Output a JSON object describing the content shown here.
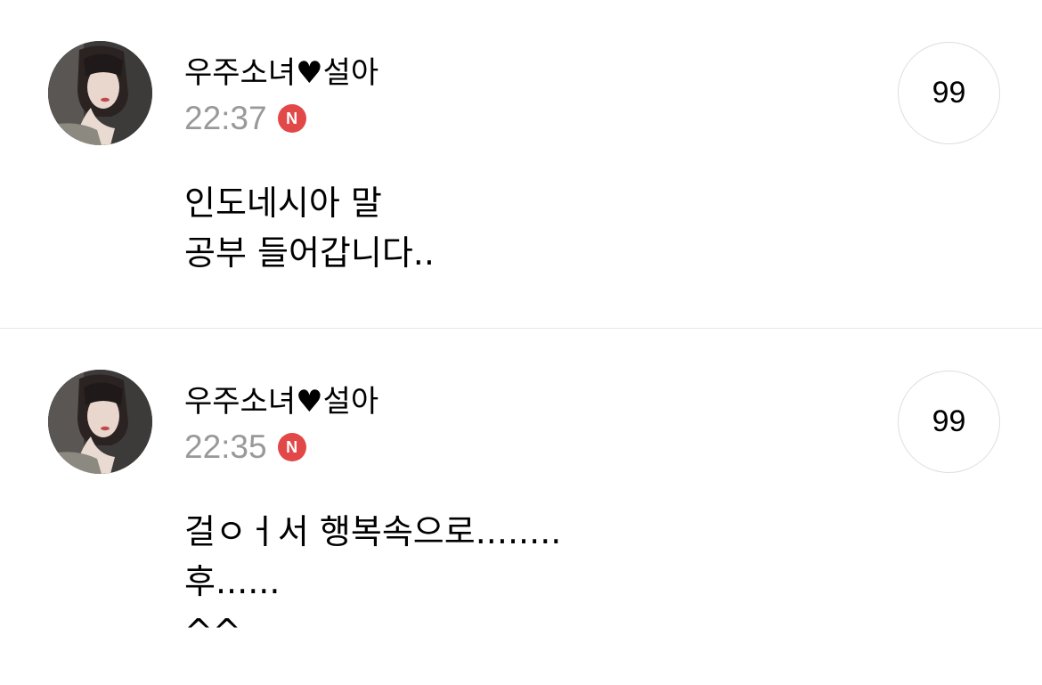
{
  "posts": [
    {
      "author": "우주소녀♥설아",
      "time": "22:37",
      "badge": "N",
      "count": "99",
      "lines": [
        "인도네시아 말",
        "공부 들어갑니다.."
      ]
    },
    {
      "author": "우주소녀♥설아",
      "time": "22:35",
      "badge": "N",
      "count": "99",
      "lines": [
        "걸ㅇㅓ서 행복속으로........",
        "후......",
        "^^"
      ]
    }
  ],
  "colors": {
    "time": "#999999",
    "badge": "#e24848",
    "divider": "#e6e6e6"
  }
}
